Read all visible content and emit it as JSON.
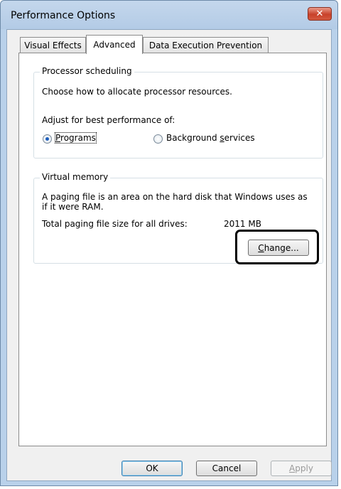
{
  "window": {
    "title": "Performance Options",
    "close_glyph": "✕"
  },
  "tabs": [
    {
      "label": "Visual Effects"
    },
    {
      "label": "Advanced"
    },
    {
      "label": "Data Execution Prevention"
    }
  ],
  "processor": {
    "group_label": "Processor scheduling",
    "description": "Choose how to allocate processor resources.",
    "adjust_label": "Adjust for best performance of:",
    "option_programs_prefix": "",
    "option_programs_mnemonic": "P",
    "option_programs_rest": "rograms",
    "option_background_prefix": "Background ",
    "option_background_mnemonic": "s",
    "option_background_rest": "ervices",
    "selected": "Programs"
  },
  "virtual_memory": {
    "group_label": "Virtual memory",
    "description_line1": "A paging file is an area on the hard disk that Windows uses as",
    "description_line2": "if it were RAM.",
    "total_label": "Total paging file size for all drives:",
    "total_value": "2011 MB",
    "change_mnemonic": "C",
    "change_rest": "hange..."
  },
  "footer": {
    "ok_label": "OK",
    "cancel_label": "Cancel",
    "apply_mnemonic": "A",
    "apply_rest": "pply"
  },
  "icons": {
    "close": "close-icon"
  }
}
